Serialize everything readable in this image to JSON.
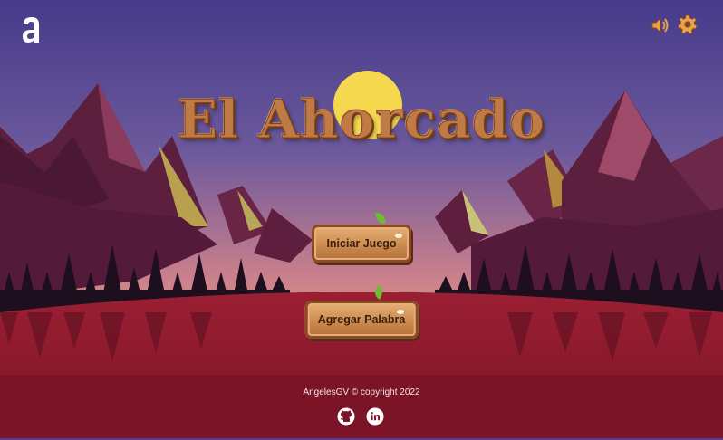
{
  "header": {
    "logo_icon": "alura-logo-icon",
    "sound_icon": "speaker-icon",
    "settings_icon": "gear-icon",
    "accent_color": "#e9a14a"
  },
  "main": {
    "title": "El Ahorcado",
    "buttons": {
      "start_label": "Iniciar Juego",
      "add_word_label": "Agregar Palabra"
    }
  },
  "footer": {
    "copyright": "AngelesGV © copyright 2022",
    "github_icon": "github-icon",
    "linkedin_icon": "linkedin-icon"
  },
  "colors": {
    "sky_top": "#4b3f8c",
    "sky_bottom": "#d9898a",
    "sun": "#f5d84d",
    "ground": "#8e1a2c",
    "footer_bg": "#7b1426",
    "wood": "#c9874c"
  }
}
